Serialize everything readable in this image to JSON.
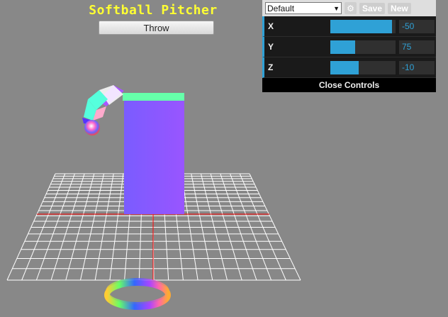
{
  "title": "Softball Pitcher",
  "throw_button": "Throw",
  "gui": {
    "preset": "Default",
    "save_label": "Save",
    "new_label": "New",
    "gear_icon": "gear-icon",
    "controls": [
      {
        "label": "X",
        "value": "-50",
        "fill": 0.95
      },
      {
        "label": "Y",
        "value": "75",
        "fill": 0.38
      },
      {
        "label": "Z",
        "value": "-10",
        "fill": 0.44
      }
    ],
    "close_label": "Close Controls",
    "accent_color": "#2fa1d6"
  },
  "colors": {
    "background": "#888888",
    "title": "#ffff33",
    "grid": "#ffffff",
    "axis": "#ff0000",
    "tower": "#8855ff",
    "tower_top": "#66ffaa"
  }
}
